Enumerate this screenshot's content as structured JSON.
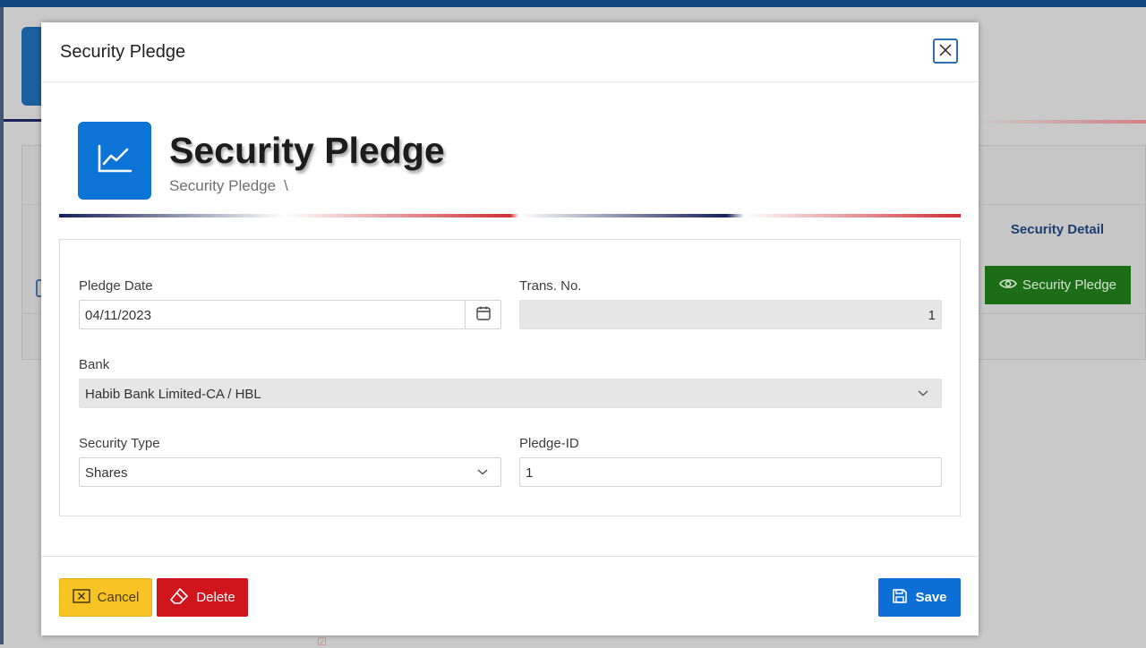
{
  "background": {
    "table_header": "Security Detail",
    "row_button_label": "Security Pledge"
  },
  "modal": {
    "title": "Security Pledge",
    "page_heading": "Security Pledge",
    "breadcrumb": "Security Pledge",
    "breadcrumb_separator": "\\",
    "fields": {
      "pledge_date": {
        "label": "Pledge Date",
        "value": "04/11/2023"
      },
      "trans_no": {
        "label": "Trans. No.",
        "value": "1"
      },
      "bank": {
        "label": "Bank",
        "value": "Habib Bank Limited-CA / HBL"
      },
      "security_type": {
        "label": "Security Type",
        "value": "Shares"
      },
      "pledge_id": {
        "label": "Pledge-ID",
        "value": "1"
      }
    },
    "buttons": {
      "cancel": "Cancel",
      "delete": "Delete",
      "save": "Save"
    }
  },
  "colors": {
    "primary_blue": "#0b74d6",
    "cancel_yellow": "#f8c425",
    "delete_red": "#d0141b",
    "save_blue": "#0d6ed6",
    "bg_green_button": "#1b6e15"
  },
  "icons": {
    "page_icon": "trend-line-chart-icon",
    "close": "close-icon",
    "date": "calendar-icon",
    "select": "chevron-down-icon",
    "cancel": "x-square-icon",
    "delete": "eraser-icon",
    "save": "floppy-disk-icon",
    "view": "eye-icon"
  }
}
